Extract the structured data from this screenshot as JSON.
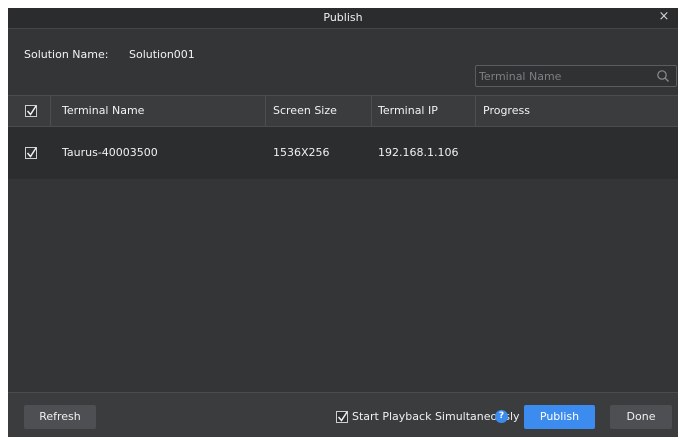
{
  "window": {
    "title": "Publish",
    "close_glyph": "×"
  },
  "solution": {
    "label": "Solution Name:",
    "value": "Solution001"
  },
  "search": {
    "placeholder": "Terminal Name",
    "value": "",
    "icon": "search-icon"
  },
  "table": {
    "header_checked": true,
    "columns": [
      "Terminal Name",
      "Screen Size",
      "Terminal IP",
      "Progress"
    ],
    "rows": [
      {
        "checked": true,
        "terminal_name": "Taurus-40003500",
        "screen_size": "1536X256",
        "terminal_ip": "192.168.1.106",
        "progress": ""
      }
    ]
  },
  "footer": {
    "refresh_label": "Refresh",
    "simultaneous_checked": true,
    "simultaneous_label": "Start Playback Simultaneously",
    "help_glyph": "?",
    "publish_label": "Publish",
    "done_label": "Done"
  },
  "colors": {
    "accent": "#3c8cf0",
    "background": "#333536",
    "header": "#3a3c3e",
    "row": "#2b2d2f"
  }
}
